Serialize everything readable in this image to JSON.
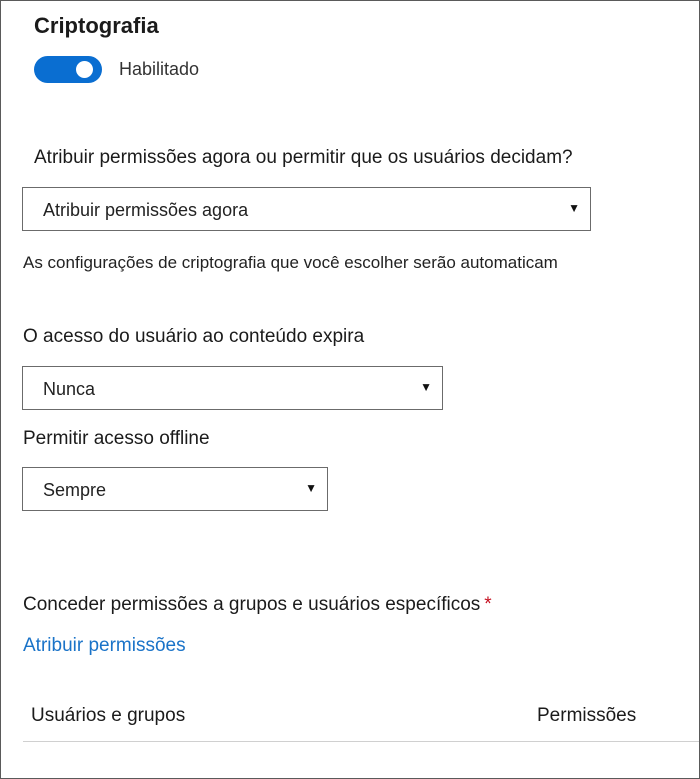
{
  "encryption": {
    "title": "Criptografia",
    "toggle_label": "Habilitado",
    "enabled": true
  },
  "assign_question": {
    "label": "Atribuir permissões agora ou permitir que os usuários decidam?",
    "selected": "Atribuir permissões agora"
  },
  "helper_text": "As configurações de criptografia que você escolher serão automaticam",
  "expiry": {
    "label": "O acesso do usuário ao conteúdo expira",
    "selected": "Nunca"
  },
  "offline": {
    "label": "Permitir acesso offline",
    "selected": "Sempre"
  },
  "grant": {
    "label": "Conceder permissões a grupos e usuários específicos",
    "required_mark": "*",
    "link": "Atribuir permissões"
  },
  "table": {
    "col_users": "Usuários e grupos",
    "col_permissions": "Permissões"
  },
  "colors": {
    "accent": "#0a6ed1",
    "link": "#1a73c8",
    "required": "#c50f1f"
  }
}
